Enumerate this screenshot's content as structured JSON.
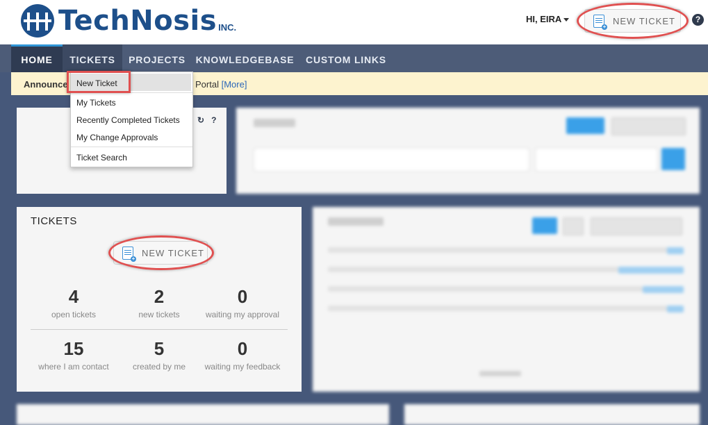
{
  "brand": {
    "name": "TechNosis",
    "suffix": "INC."
  },
  "user_menu": {
    "label": "HI, EIRA"
  },
  "header": {
    "new_ticket_label": "NEW TICKET",
    "help_glyph": "?"
  },
  "nav": {
    "items": [
      {
        "label": "HOME"
      },
      {
        "label": "TICKETS"
      },
      {
        "label": "PROJECTS"
      },
      {
        "label": "KNOWLEDGEBASE"
      },
      {
        "label": "CUSTOM LINKS"
      }
    ]
  },
  "announcement": {
    "prefix": "Announce",
    "suffix": "Portal",
    "more": "[More]"
  },
  "dropdown": {
    "items": [
      {
        "label": "New Ticket"
      },
      {
        "label": "My Tickets"
      },
      {
        "label": "Recently Completed Tickets"
      },
      {
        "label": "My Change Approvals"
      },
      {
        "label": "Ticket Search"
      }
    ]
  },
  "tickets_widget": {
    "title": "TICKETS",
    "new_ticket_label": "NEW TICKET",
    "stats": [
      {
        "value": "4",
        "caption": "open tickets"
      },
      {
        "value": "2",
        "caption": "new tickets"
      },
      {
        "value": "0",
        "caption": "waiting my approval"
      },
      {
        "value": "15",
        "caption": "where I am contact"
      },
      {
        "value": "5",
        "caption": "created by me"
      },
      {
        "value": "0",
        "caption": "waiting my feedback"
      }
    ]
  },
  "colors": {
    "accent": "#2f95d6",
    "nav_bg": "#4d5c78",
    "highlight": "#e05050",
    "brand": "#1d4f8a"
  }
}
